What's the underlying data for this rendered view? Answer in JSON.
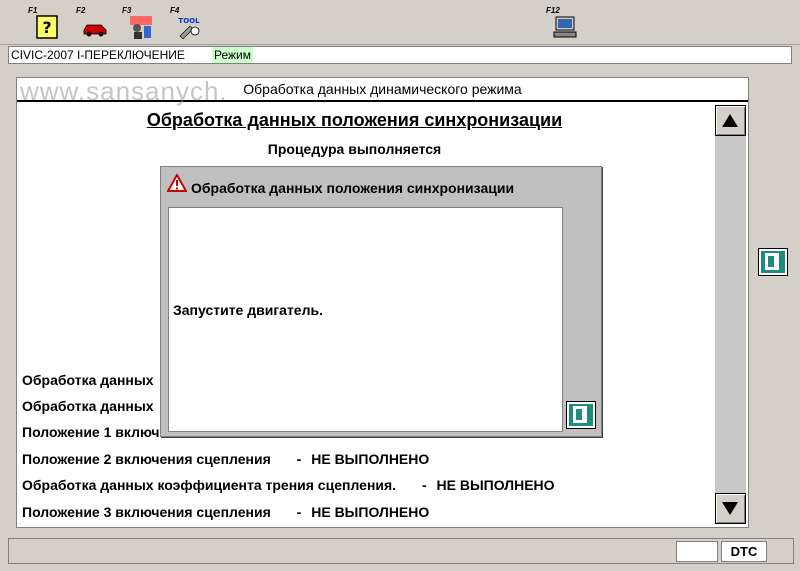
{
  "toolbar": {
    "keys": [
      {
        "label": "F1",
        "icon": "help-icon"
      },
      {
        "label": "F2",
        "icon": "car-icon"
      },
      {
        "label": "F3",
        "icon": "mechanic-icon"
      },
      {
        "label": "F4",
        "icon": "tool-icon"
      },
      {
        "label": "F12",
        "icon": "computer-icon"
      }
    ],
    "tool_icon_text": "TOOL"
  },
  "status": {
    "vehicle": "CIVIC-2007 I-ПЕРЕКЛЮЧЕНИЕ",
    "mode": "Режим"
  },
  "watermark": "www.sansanych.",
  "panel": {
    "title": "Обработка данных динамического режима",
    "heading": "Обработка данных положения синхронизации",
    "procedure_status": "Процедура выполняется",
    "lines": [
      {
        "text": "Обработка данных",
        "status": ""
      },
      {
        "text": "Обработка данных",
        "status": ""
      },
      {
        "text": "Положение 1 включ",
        "status": ""
      },
      {
        "text": "Положение 2 включения сцепления",
        "sep": "-",
        "status": "НЕ ВЫПОЛНЕНО"
      },
      {
        "text": "Обработка данных коэффициента трения сцепления.",
        "sep": "-",
        "status": "НЕ ВЫПОЛНЕНО"
      },
      {
        "text": "Положение 3 включения сцепления",
        "sep": "-",
        "status": "НЕ ВЫПОЛНЕНО"
      }
    ]
  },
  "dialog": {
    "title": "Обработка данных положения синхронизации",
    "message": "Запустите двигатель."
  },
  "bottom": {
    "dtc_label": "DTC"
  },
  "colors": {
    "background": "#d4d0c8",
    "mode_highlight": "#ccffcc",
    "exit_icon": "#1d8c7e",
    "warning_red": "#cc0000"
  }
}
